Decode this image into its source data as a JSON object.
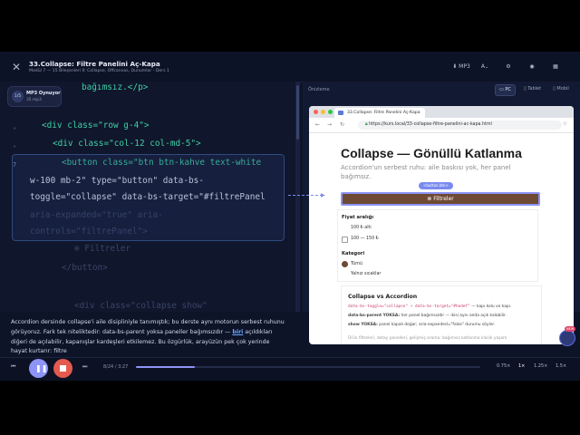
{
  "header": {
    "title": "33.Collapse: Filtre Panelini Aç-Kapa",
    "subtitle": "Modül 7 — 15 Bileşenleri II: Collapse, Offcanvas, Dunumlar - Ders 1",
    "mp3_label": "MP3",
    "icons": [
      "close-icon",
      "cc-icon",
      "settings-icon",
      "record-icon",
      "grid-icon"
    ]
  },
  "mp3_pill": {
    "avatar": "1/5",
    "title": "MP3 Oynuyor",
    "meta": "35.mp3"
  },
  "editor": {
    "lines": [
      {
        "num": "",
        "text": "bağımsız.</p>"
      },
      {
        "num": "",
        "text": "<div class=\"row g-4\">"
      },
      {
        "num": "",
        "text": "<div class=\"col-12 col-md-5\">"
      },
      {
        "num": "7",
        "text": "<button class=\"btn btn-kahve text-white"
      },
      {
        "num": "",
        "text": "w-100 mb-2\" type=\"button\" data-bs-"
      },
      {
        "num": "",
        "text": "toggle=\"collapse\" data-bs-target=\"#filtrePanel"
      },
      {
        "num": "",
        "text": "aria-expanded=\"true\" aria-"
      },
      {
        "num": "",
        "text": "controls=\"filtrePanel\">"
      },
      {
        "num": "",
        "text": "Filtreler"
      },
      {
        "num": "",
        "text": "</button>"
      },
      {
        "num": "",
        "text": "<div class=\"collapse show\""
      }
    ]
  },
  "preview": {
    "label": "Önizleme",
    "devices": [
      "PC",
      "Tablet",
      "Mobil"
    ],
    "active_device": "PC",
    "tab_title": "33.Collapse: Filtre Panelini Aç-Kapa",
    "url": "https://kurs.local/33-collapse-filtre-panelini-ac-kapa.html",
    "page_title": "Collapse — Gönüllü Katlanma",
    "lead": "Accordion'un serbest ruhu: aile baskısı yok, her panel bağımsız.",
    "badge": "<button.btn>",
    "button_label": "Filtreler",
    "price_heading": "Fiyat aralığı",
    "price_items": [
      "100 ₺ altı",
      "100 — 150 ₺"
    ],
    "category_heading": "Kategori",
    "category_items": [
      "Tümü",
      "Yalnız sıcaklar"
    ],
    "compare_title": "Collapse vs Accordion",
    "compare_line1_code": "data-bs-toggle=\"collapse\" + data-bs-target=\"#hedef\"",
    "compare_line1_text": " — kapı kolu ve kapı.",
    "compare_line2_bold": "data-bs-parent YOKSA:",
    "compare_line2_text": " her panel bağımsızdır — ikisi aynı anda açık kalabilir.",
    "compare_line3_bold": "show YOKSA:",
    "compare_line3_text": " panel kapalı doğar; aria-expanded=\"false\" durumu söyler.",
    "compare_line4": "Ürün filtreleri, detay panelleri, gelişmiş arama: bağımsız katlanma klasik yaşam"
  },
  "caption": {
    "before": "Accordion dersinde collapse'i aile disipliniyle tanımıştık; bu derste aynı motorun serbest ruhunu görüyoruz. Fark tek niteliktedir: data-bs-parent yoksa paneller bağımsızdır — ",
    "highlight": "biri",
    "after": " açıldıkları diğeri de açılabilir, kapanışlar kardeşleri etkilemez. Bu özgürlük, arayüzün pek çok yerinde hayat kurtarır: filtre"
  },
  "player": {
    "time": "8/24 / 3:27",
    "progress": 0.17,
    "speeds": [
      "0.75×",
      "1×",
      "1.25×",
      "1.5×"
    ],
    "active_speed": "1×"
  },
  "colors": {
    "accent": "#8d94f5",
    "stop": "#e45a4e",
    "brand_button": "#6e4a34",
    "tag_green": "#3fd0a4"
  }
}
